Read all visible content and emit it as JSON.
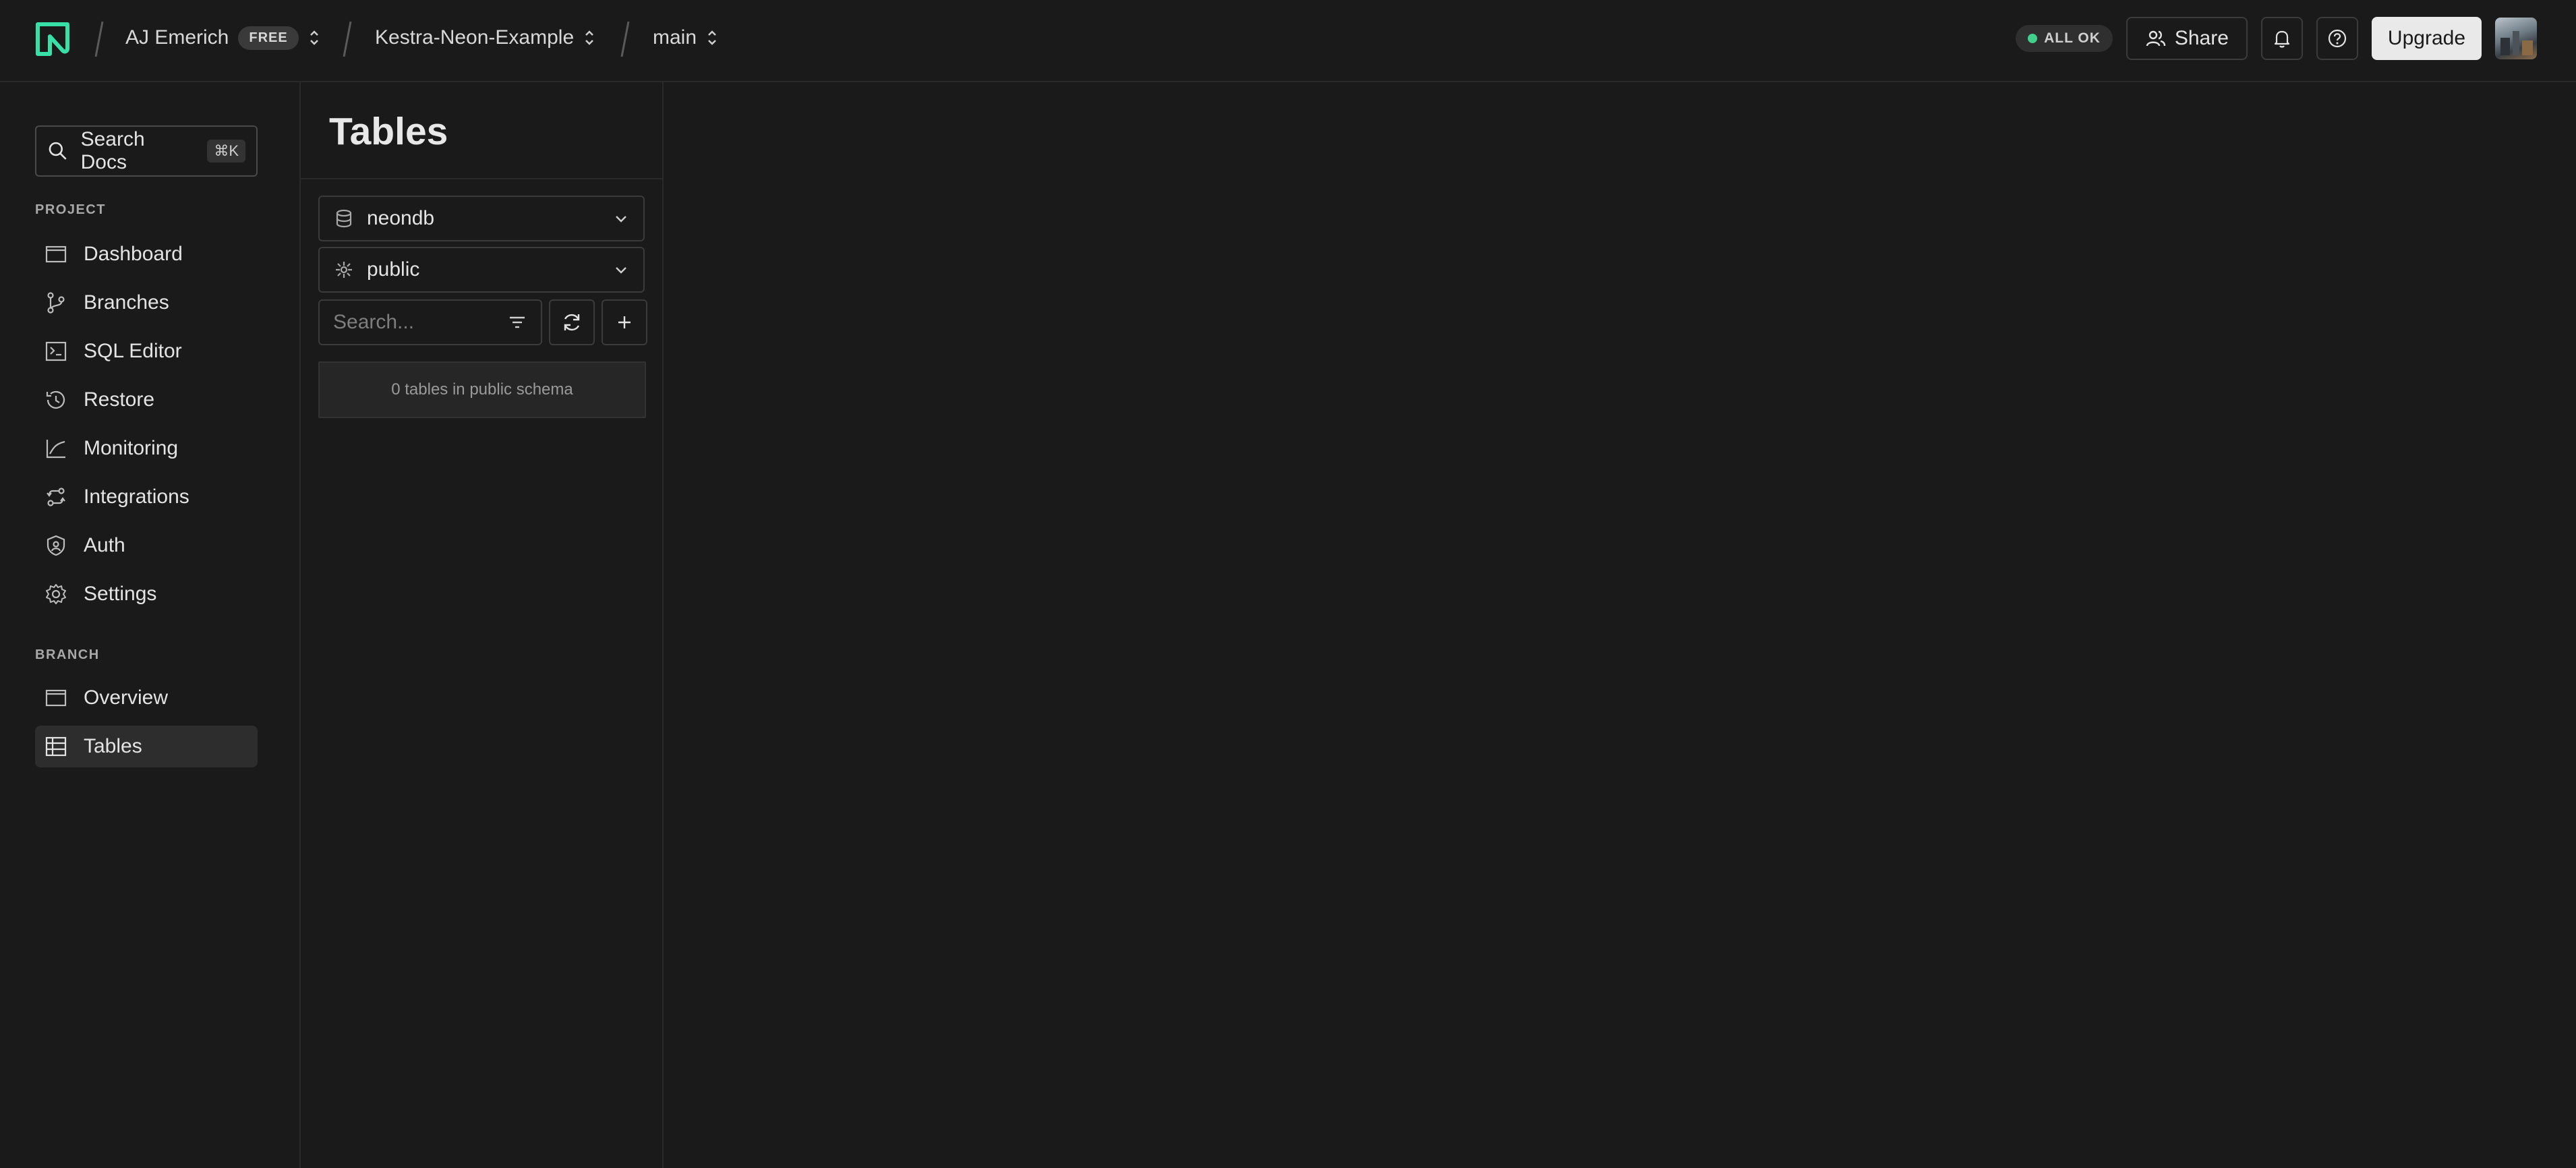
{
  "topbar": {
    "org_name": "AJ Emerich",
    "plan_badge": "FREE",
    "project_name": "Kestra-Neon-Example",
    "branch_name": "main",
    "status_text": "ALL OK",
    "share_label": "Share",
    "upgrade_label": "Upgrade",
    "icons": [
      "neon-logo-icon",
      "users-icon",
      "bell-icon",
      "help-icon",
      "chevron-updown-icon"
    ],
    "status_color": "#3fd18c"
  },
  "sidebar": {
    "search": {
      "label": "Search Docs",
      "shortcut": "⌘K"
    },
    "project_section": "PROJECT",
    "project_items": [
      {
        "label": "Dashboard",
        "icon": "dashboard-icon"
      },
      {
        "label": "Branches",
        "icon": "branches-icon"
      },
      {
        "label": "SQL Editor",
        "icon": "sql-editor-icon"
      },
      {
        "label": "Restore",
        "icon": "restore-icon"
      },
      {
        "label": "Monitoring",
        "icon": "monitoring-icon"
      },
      {
        "label": "Integrations",
        "icon": "integrations-icon"
      },
      {
        "label": "Auth",
        "icon": "auth-icon"
      },
      {
        "label": "Settings",
        "icon": "settings-icon"
      }
    ],
    "branch_section": "BRANCH",
    "branch_items": [
      {
        "label": "Overview",
        "icon": "overview-icon"
      },
      {
        "label": "Tables",
        "icon": "tables-icon",
        "active": true
      }
    ]
  },
  "tables_panel": {
    "title": "Tables",
    "database_select": "neondb",
    "schema_select": "public",
    "search_placeholder": "Search...",
    "empty_message": "0 tables in public schema"
  }
}
